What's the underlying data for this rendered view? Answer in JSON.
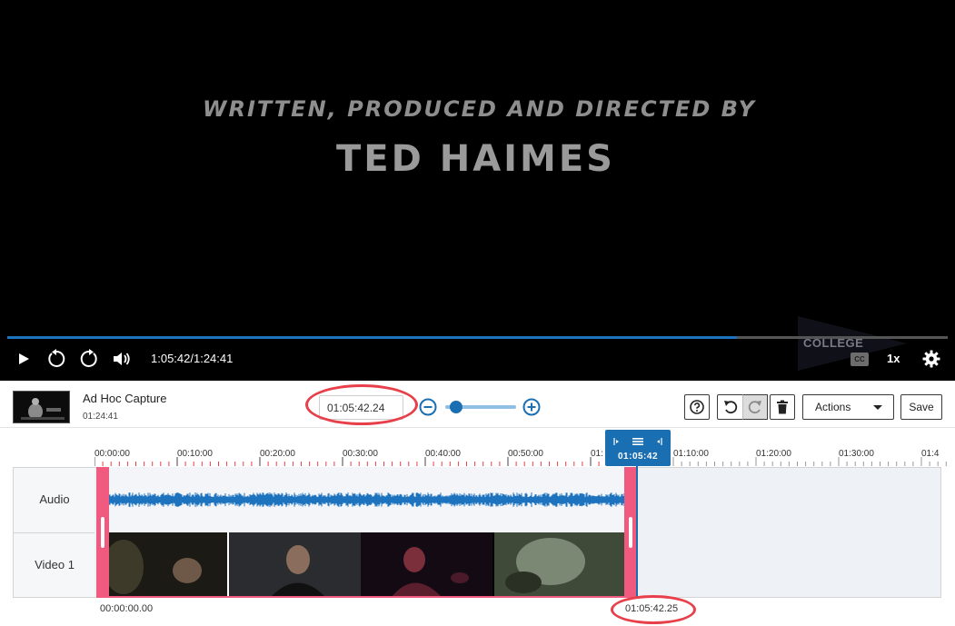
{
  "player": {
    "credit_line1": "WRITTEN, PRODUCED AND DIRECTED BY",
    "credit_line2": "TED HAIMES",
    "watermark": "COLLEGE",
    "time_readout": "1:05:42/1:24:41",
    "progress": 0.776,
    "cc_label": "CC",
    "speed": "1x",
    "accent_color": "#1e73be"
  },
  "header": {
    "title": "Ad Hoc Capture",
    "duration": "01:24:41",
    "time_input_value": "01:05:42.24",
    "zoom_level": 0.09,
    "actions_label": "Actions",
    "save_label": "Save"
  },
  "timeline": {
    "ruler_ticks": [
      "00:00:00",
      "00:10:00",
      "00:20:00",
      "00:30:00",
      "00:40:00",
      "00:50:00",
      "01:",
      "01:10:00",
      "01:20:00",
      "01:30:00",
      "01:4"
    ],
    "playhead_time": "01:05:42",
    "tracks": [
      "Audio",
      "Video 1"
    ],
    "start_time": "00:00:00.00",
    "end_time": "01:05:42.25",
    "selection_color": "#f05a7e",
    "playhead_color": "#1a6fb3",
    "annotation_color": "#e8404a"
  }
}
